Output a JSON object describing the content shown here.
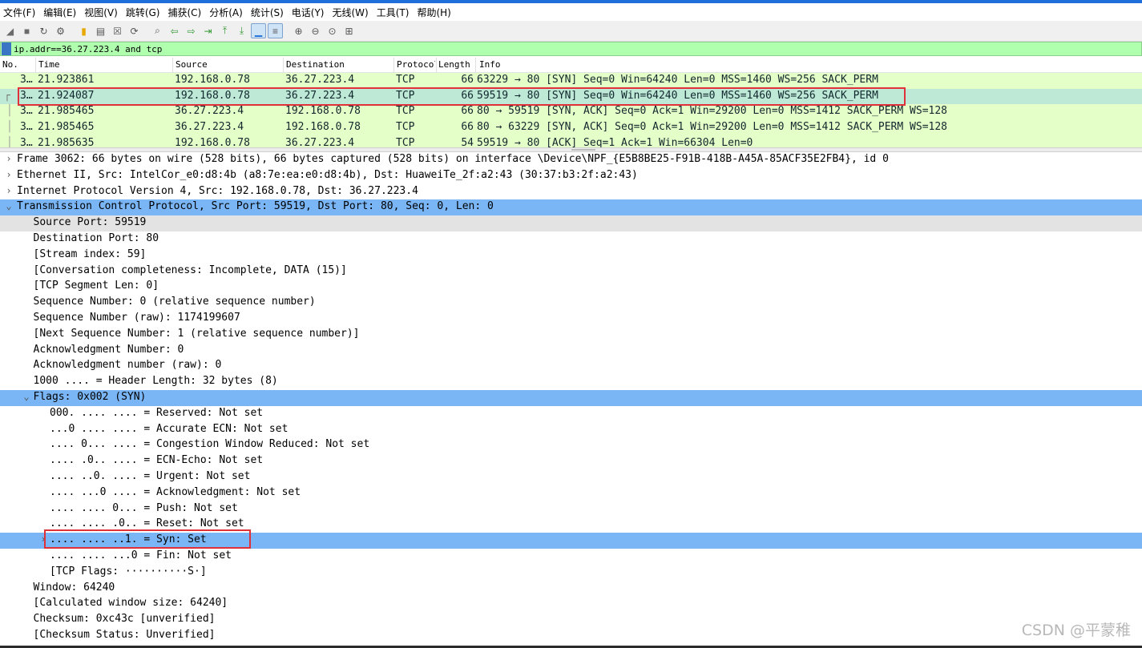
{
  "menu": [
    "文件(F)",
    "编辑(E)",
    "视图(V)",
    "跳转(G)",
    "捕获(C)",
    "分析(A)",
    "统计(S)",
    "电话(Y)",
    "无线(W)",
    "工具(T)",
    "帮助(H)"
  ],
  "toolbar_icons": [
    "start-capture-icon",
    "stop-capture-icon",
    "restart-capture-icon",
    "options-icon",
    "open-file-icon",
    "save-file-icon",
    "close-file-icon",
    "reload-icon",
    "find-packet-icon",
    "go-back-icon",
    "go-forward-icon",
    "go-to-packet-icon",
    "go-first-icon",
    "go-last-icon",
    "autoscroll-icon",
    "colorize-icon",
    "zoom-in-icon",
    "zoom-out-icon",
    "zoom-normal-icon",
    "resize-columns-icon"
  ],
  "filter": {
    "value": "ip.addr==36.27.223.4 and tcp"
  },
  "columns": {
    "no": "No.",
    "time": "Time",
    "source": "Source",
    "destination": "Destination",
    "protocol": "Protocol",
    "length": "Length",
    "info": "Info"
  },
  "packets": [
    {
      "no": "3…",
      "time": "21.923861",
      "source": "192.168.0.78",
      "destination": "36.27.223.4",
      "protocol": "TCP",
      "length": "66",
      "info": "63229 → 80 [SYN] Seq=0 Win=64240 Len=0 MSS=1460 WS=256 SACK_PERM"
    },
    {
      "no": "3…",
      "time": "21.924087",
      "source": "192.168.0.78",
      "destination": "36.27.223.4",
      "protocol": "TCP",
      "length": "66",
      "info": "59519 → 80 [SYN] Seq=0 Win=64240 Len=0 MSS=1460 WS=256 SACK_PERM"
    },
    {
      "no": "3…",
      "time": "21.985465",
      "source": "36.27.223.4",
      "destination": "192.168.0.78",
      "protocol": "TCP",
      "length": "66",
      "info": "80 → 59519 [SYN, ACK] Seq=0 Ack=1 Win=29200 Len=0 MSS=1412 SACK_PERM WS=128"
    },
    {
      "no": "3…",
      "time": "21.985465",
      "source": "36.27.223.4",
      "destination": "192.168.0.78",
      "protocol": "TCP",
      "length": "66",
      "info": "80 → 63229 [SYN, ACK] Seq=0 Ack=1 Win=29200 Len=0 MSS=1412 SACK_PERM WS=128"
    },
    {
      "no": "3…",
      "time": "21.985635",
      "source": "192.168.0.78",
      "destination": "36.27.223.4",
      "protocol": "TCP",
      "length": "54",
      "info": "59519 → 80 [ACK] Seq=1 Ack=1 Win=66304 Len=0"
    }
  ],
  "details": [
    {
      "arrow": "›",
      "text": "Frame 3062: 66 bytes on wire (528 bits), 66 bytes captured (528 bits) on interface \\Device\\NPF_{E5B8BE25-F91B-418B-A45A-85ACF35E2FB4}, id 0"
    },
    {
      "arrow": "›",
      "text": "Ethernet II, Src: IntelCor_e0:d8:4b (a8:7e:ea:e0:d8:4b), Dst: HuaweiTe_2f:a2:43 (30:37:b3:2f:a2:43)"
    },
    {
      "arrow": "›",
      "text": "Internet Protocol Version 4, Src: 192.168.0.78, Dst: 36.27.223.4"
    },
    {
      "arrow": "⌄",
      "text": "Transmission Control Protocol, Src Port: 59519, Dst Port: 80, Seq: 0, Len: 0"
    },
    {
      "arrow": "",
      "text": "Source Port: 59519"
    },
    {
      "arrow": "",
      "text": "Destination Port: 80"
    },
    {
      "arrow": "",
      "text": "[Stream index: 59]"
    },
    {
      "arrow": "",
      "text": "[Conversation completeness: Incomplete, DATA (15)]"
    },
    {
      "arrow": "",
      "text": "[TCP Segment Len: 0]"
    },
    {
      "arrow": "",
      "text": "Sequence Number: 0    (relative sequence number)"
    },
    {
      "arrow": "",
      "text": "Sequence Number (raw): 1174199607"
    },
    {
      "arrow": "",
      "text": "[Next Sequence Number: 1    (relative sequence number)]"
    },
    {
      "arrow": "",
      "text": "Acknowledgment Number: 0"
    },
    {
      "arrow": "",
      "text": "Acknowledgment number (raw): 0"
    },
    {
      "arrow": "",
      "text": "1000 .... = Header Length: 32 bytes (8)"
    },
    {
      "arrow": "⌄",
      "text": "Flags: 0x002 (SYN)"
    },
    {
      "arrow": "",
      "text": "000. .... .... = Reserved: Not set"
    },
    {
      "arrow": "",
      "text": "...0 .... .... = Accurate ECN: Not set"
    },
    {
      "arrow": "",
      "text": ".... 0... .... = Congestion Window Reduced: Not set"
    },
    {
      "arrow": "",
      "text": ".... .0.. .... = ECN-Echo: Not set"
    },
    {
      "arrow": "",
      "text": ".... ..0. .... = Urgent: Not set"
    },
    {
      "arrow": "",
      "text": ".... ...0 .... = Acknowledgment: Not set"
    },
    {
      "arrow": "",
      "text": ".... .... 0... = Push: Not set"
    },
    {
      "arrow": "",
      "text": ".... .... .0.. = Reset: Not set"
    },
    {
      "arrow": "›",
      "text": ".... .... ..1. = Syn: Set"
    },
    {
      "arrow": "",
      "text": ".... .... ...0 = Fin: Not set"
    },
    {
      "arrow": "",
      "text": "[TCP Flags: ··········S·]"
    },
    {
      "arrow": "",
      "text": "Window: 64240"
    },
    {
      "arrow": "",
      "text": "[Calculated window size: 64240]"
    },
    {
      "arrow": "",
      "text": "Checksum: 0xc43c [unverified]"
    },
    {
      "arrow": "",
      "text": "[Checksum Status: Unverified]"
    }
  ],
  "watermark": "CSDN @平蒙稚"
}
